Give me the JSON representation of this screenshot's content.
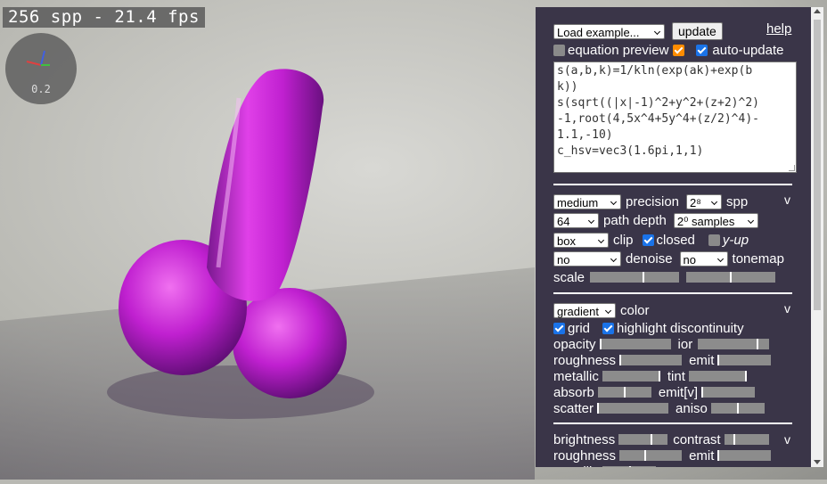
{
  "status": {
    "fps_text": "256 spp - 21.4 fps",
    "axes_scale": "0.2"
  },
  "toolbar": {
    "example_select": "Load example...",
    "update_label": "update",
    "help_label": "help",
    "equation_preview_label": "equation preview",
    "auto_update_label": "auto-update"
  },
  "editor": {
    "lines": [
      "s(a,b,k)=1/kln(exp(ak)+exp(b",
      "k))",
      "s(sqrt((|x|-1)^2+y^2+(z+2)^2)",
      "-1,root(4,5x^4+5y^4+(z/2)^4)-",
      "1.1,-10)",
      "c_hsv=vec3(1.6pi,1,1)"
    ]
  },
  "render": {
    "precision_value": "medium",
    "precision_label": "precision",
    "spp_value": "2⁸",
    "spp_label": "spp",
    "collapse_mark": "v",
    "depth_value": "64",
    "depth_label": "path depth",
    "samples_value": "2⁰ samples",
    "clip_value": "box",
    "clip_label": "clip",
    "closed_label": "closed",
    "yup_label": "y-up",
    "denoise_value": "no",
    "denoise_label": "denoise",
    "tonemap_value": "no",
    "tonemap_label": "tonemap",
    "scale_label": "scale"
  },
  "material": {
    "color_value": "gradient",
    "color_label": "color",
    "collapse_mark": "v",
    "grid_label": "grid",
    "highlight_label": "highlight discontinuity",
    "opacity_label": "opacity",
    "ior_label": "ior",
    "roughness_label": "roughness",
    "emit_label": "emit",
    "metallic_label": "metallic",
    "tint_label": "tint",
    "absorb_label": "absorb",
    "emitv_label": "emit[v]",
    "scatter_label": "scatter",
    "aniso_label": "aniso"
  },
  "lighting": {
    "brightness_label": "brightness",
    "contrast_label": "contrast",
    "collapse_mark": "v",
    "roughness_label": "roughness",
    "emit_label": "emit",
    "partial_label": "metallic"
  },
  "colors": {
    "panel_bg": "#3a3548",
    "object": "#d020d8",
    "accent": "#1a73e8"
  }
}
